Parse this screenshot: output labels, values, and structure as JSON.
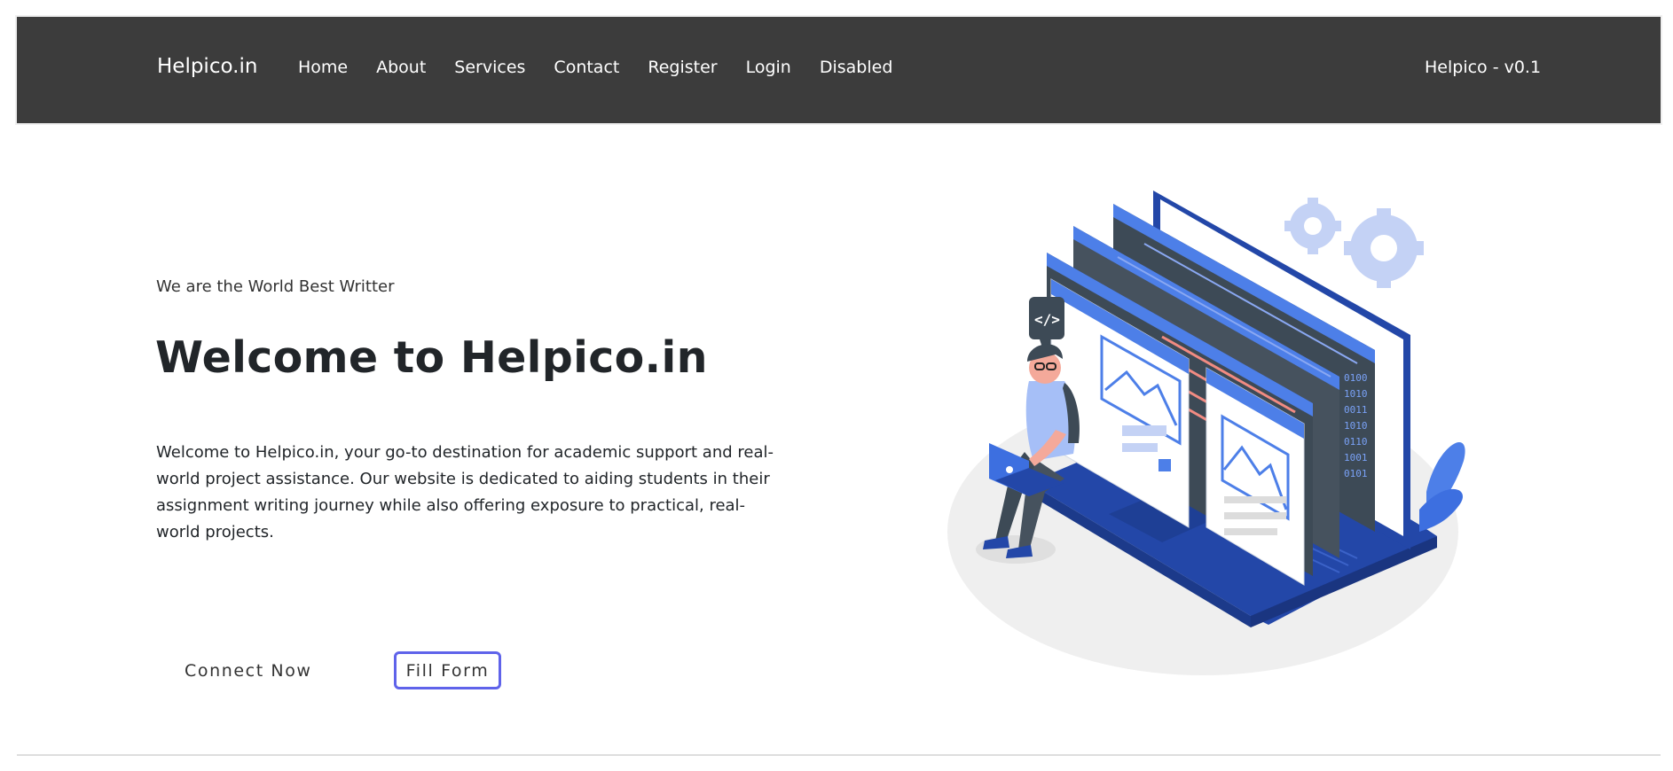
{
  "nav": {
    "brand": "Helpico.in",
    "links": [
      "Home",
      "About",
      "Services",
      "Contact",
      "Register",
      "Login",
      "Disabled"
    ],
    "version": "Helpico - v0.1"
  },
  "hero": {
    "tagline": "We are the World Best Writter",
    "title": "Welcome to Helpico.in",
    "description": "Welcome to Helpico.in, your go-to destination for academic support and real-world project assistance. Our website is dedicated to aiding students in their assignment writing journey while also offering exposure to practical, real-world projects.",
    "connect_button": "Connect Now",
    "form_button": "Fill Form"
  },
  "illustration": {
    "icon": "developer-laptop-illustration"
  },
  "colors": {
    "navbar": "#3c3c3c",
    "accent": "#5f63ea",
    "illustration_blue": "#3d6fe0",
    "illustration_dark": "#2347a8"
  }
}
